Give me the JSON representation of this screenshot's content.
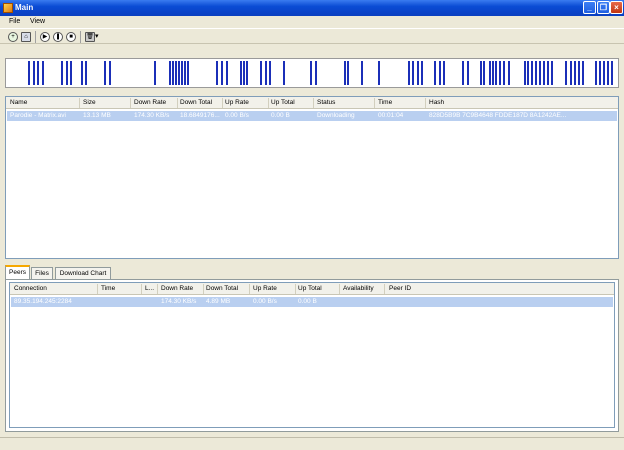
{
  "window": {
    "title": "Main"
  },
  "menu": {
    "file": "File",
    "view": "View"
  },
  "toolbar": {
    "icons": [
      "add-icon",
      "home-icon",
      "play-icon",
      "pause-icon",
      "stop-icon",
      "delete-icon",
      "dropdown-arrow-icon"
    ],
    "dropdown_glyph": "▾"
  },
  "colors": {
    "titlebar": "#0a4bd4",
    "selection": "#b9cff0",
    "bar": "#1b2fb8",
    "tab_highlight": "#f6a800"
  },
  "torrents": {
    "columns": [
      "Name",
      "Size",
      "Down Rate",
      "Down Total",
      "Up Rate",
      "Up Total",
      "Status",
      "Time",
      "Hash"
    ],
    "rows": [
      {
        "name": "Parodie - Matrix.avi",
        "size": "13.13 MB",
        "down_rate": "174.30 KB/s",
        "down_total": "18.6849176...",
        "up_rate": "0.00 B/s",
        "up_total": "0.00 B",
        "status": "Downloading",
        "time": "00:01:04",
        "hash": "828D5B9B 7C9B4648 FDDE187D 8A1242AE..."
      }
    ]
  },
  "tabs": [
    "Peers",
    "Files",
    "Download Chart"
  ],
  "peers": {
    "columns": [
      "Connection",
      "Time",
      "L...",
      "Down Rate",
      "Down Total",
      "Up Rate",
      "Up Total",
      "Availability",
      "Peer ID"
    ],
    "rows": [
      {
        "connection": "89.35.194.245:2284",
        "time": "",
        "l": "",
        "down_rate": "174.30 KB/s",
        "down_total": "4.89 MB",
        "up_rate": "0.00 B/s",
        "up_total": "0.00 B",
        "availability": "",
        "peer_id": ""
      }
    ]
  }
}
